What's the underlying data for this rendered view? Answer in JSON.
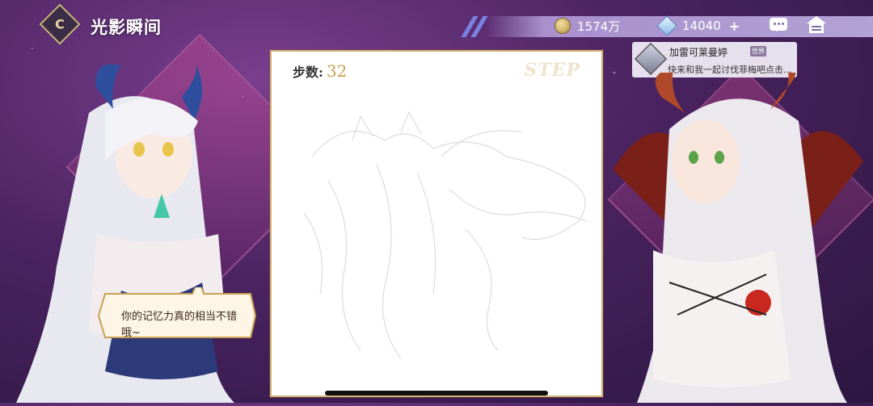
{
  "header": {
    "title": "光影瞬间",
    "back_glyph": "C"
  },
  "resources": {
    "gold": {
      "icon": "coin-icon",
      "value": "1574万"
    },
    "gems": {
      "icon": "gem-icon",
      "value": "14040",
      "add_label": "+"
    }
  },
  "actions": {
    "chat_icon": "chat-icon",
    "home_icon": "home-icon"
  },
  "chat_notice": {
    "name": "加雷可莱曼婷",
    "badge": "世界",
    "message": "快来和我一起讨伐菲梅吧点击..."
  },
  "panel": {
    "steps_label": "步数:",
    "steps_value": "32",
    "watermark": "STEP"
  },
  "dialogue": {
    "text": "你的记忆力真的相当不错哦~"
  },
  "colors": {
    "accent_gold": "#c9a050",
    "panel_border": "#d4b17a",
    "bg_purple": "#4a2360"
  }
}
